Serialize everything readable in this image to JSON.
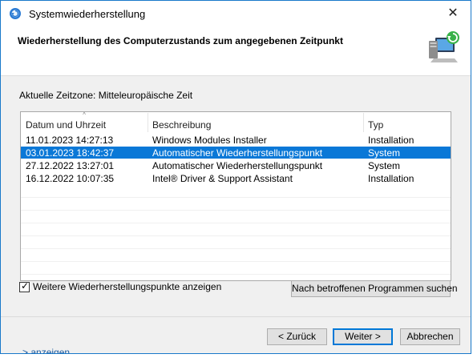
{
  "window": {
    "title": "Systemwiederherstellung",
    "close_glyph": "✕"
  },
  "header": {
    "title": "Wiederherstellung des Computerzustands zum angegebenen Zeitpunkt"
  },
  "timezone_label": "Aktuelle Zeitzone: Mitteleuropäische Zeit",
  "table": {
    "columns": [
      "Datum und Uhrzeit",
      "Beschreibung",
      "Typ"
    ],
    "rows": [
      {
        "date": "11.01.2023 14:27:13",
        "description": "Windows Modules Installer",
        "type": "Installation",
        "selected": false
      },
      {
        "date": "03.01.2023 18:42:37",
        "description": "Automatischer Wiederherstellungspunkt",
        "type": "System",
        "selected": true
      },
      {
        "date": "27.12.2022 13:27:01",
        "description": "Automatischer Wiederherstellungspunkt",
        "type": "System",
        "selected": false
      },
      {
        "date": "16.12.2022 10:07:35",
        "description": "Intel® Driver & Support Assistant",
        "type": "Installation",
        "selected": false
      }
    ]
  },
  "show_more": {
    "label": "Weitere Wiederherstellungspunkte anzeigen",
    "checked": true
  },
  "buttons": {
    "scan": "Nach betroffenen Programmen suchen",
    "back": "< Zurück",
    "next": "Weiter >",
    "cancel": "Abbrechen"
  },
  "background_fragment": "> anzeigen",
  "colors": {
    "selection": "#0a78d7",
    "border": "#1979ca"
  },
  "icons": [
    "system-restore-icon",
    "restore-computer-icon",
    "close-icon",
    "sort-indicator-icon",
    "checkmark-icon"
  ]
}
